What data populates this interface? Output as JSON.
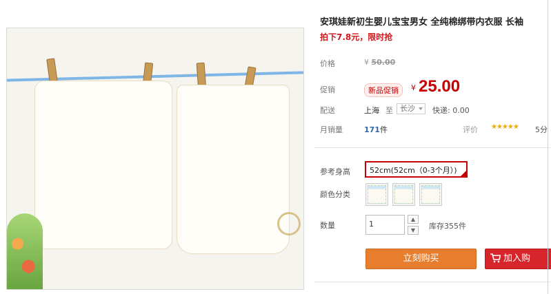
{
  "product": {
    "title": "安琪娃新初生婴儿宝宝男女 全纯棉绑带内衣服 长袖",
    "promo_line": "拍下7.8元，限时抢"
  },
  "price_block": {
    "original_label": "价格",
    "original_currency": "¥",
    "original_price": "50.00",
    "promo_label": "促销",
    "promo_badge": "新品促销",
    "promo_currency": "¥",
    "promo_price": "25.00"
  },
  "delivery": {
    "label": "配送",
    "from": "上海",
    "to_label": "至",
    "to_city": "长沙",
    "express": "快递: 0.00"
  },
  "sales": {
    "label": "月销量",
    "count": "171",
    "unit": "件",
    "rating_label": "评价",
    "stars": "★★★★★",
    "rating_score": "5分"
  },
  "options": {
    "size_label": "参考身高",
    "size_value": "52cm(52cm（0-3个月）)",
    "color_label": "颜色分类",
    "qty_label": "数量",
    "qty_value": "1",
    "qty_up": "▲",
    "qty_down": "▼",
    "stock": "库存355件"
  },
  "actions": {
    "buy_now": "立刻购买",
    "add_cart": "加入购"
  },
  "icons": {
    "cart": "cart-icon",
    "qty_up": "caret-up-icon",
    "qty_down": "caret-down-icon",
    "city_dropdown": "chevron-down-icon"
  },
  "colors": {
    "price_red": "#c40000",
    "buy_orange": "#e67e2e",
    "cart_red": "#d7262b",
    "star_gold": "#f0a800"
  }
}
